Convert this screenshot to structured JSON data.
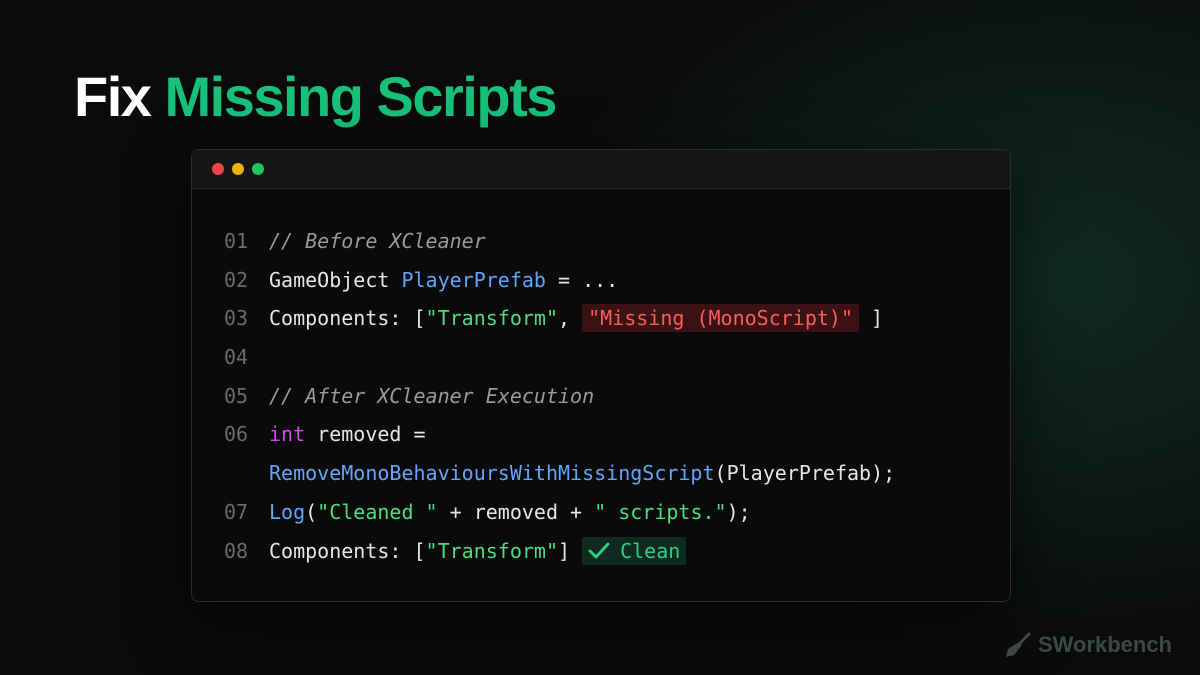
{
  "title": {
    "part1": "Fix",
    "part2": "Missing Scripts"
  },
  "colors": {
    "accent_green": "#18c07a",
    "error_red": "#ff5a5a",
    "string_green": "#4ade80",
    "type_blue": "#60a5fa",
    "keyword_magenta": "#d946ef",
    "comment_gray": "#9a9a9a"
  },
  "window": {
    "controls": [
      "close-dot-red",
      "minimize-dot-yellow",
      "maximize-dot-green"
    ]
  },
  "code": {
    "l1": {
      "num": "01",
      "comment": "// Before XCleaner"
    },
    "l2": {
      "num": "02",
      "type": "GameObject",
      "var": "PlayerPrefab",
      "rest": " = ..."
    },
    "l3": {
      "num": "03",
      "prefix": "Components: [",
      "str1": "\"Transform\"",
      "sep": ", ",
      "error": "\"Missing (MonoScript)\"",
      "suffix": " ]"
    },
    "l4": {
      "num": "04"
    },
    "l5": {
      "num": "05",
      "comment": "// After XCleaner Execution"
    },
    "l6": {
      "num": "06",
      "kw": "int",
      "rest": " removed ="
    },
    "l6b": {
      "fn": "RemoveMonoBehavioursWithMissingScript",
      "args": "(PlayerPrefab);"
    },
    "l7": {
      "num": "07",
      "fn": "Log",
      "open": "(",
      "str1": "\"Cleaned \"",
      "mid": " + removed + ",
      "str2": "\" scripts.\"",
      "close": ");"
    },
    "l8": {
      "num": "08",
      "prefix": "Components: [",
      "str1": "\"Transform\"",
      "suffix": "] ",
      "badge": "Clean",
      "badge_icon": "check-icon"
    }
  },
  "brand": {
    "name": "SWorkbench",
    "icon": "broom-icon"
  }
}
